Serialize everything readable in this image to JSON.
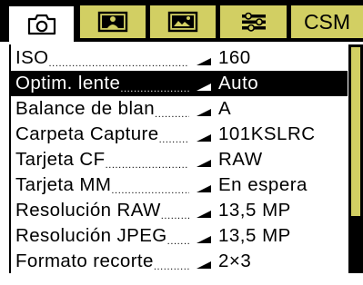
{
  "tabs": [
    {
      "id": "camera",
      "icon": "camera-icon",
      "active": true
    },
    {
      "id": "playback",
      "icon": "playback-icon",
      "active": false
    },
    {
      "id": "image",
      "icon": "image-icon",
      "active": false
    },
    {
      "id": "setup",
      "icon": "wrench-icon",
      "active": false
    },
    {
      "id": "csm",
      "label": "CSM",
      "active": false
    }
  ],
  "menu": {
    "items": [
      {
        "label": "ISO",
        "value": "160",
        "selected": false
      },
      {
        "label": "Optim. lente",
        "value": "Auto",
        "selected": true
      },
      {
        "label": "Balance de blan",
        "value": "A",
        "selected": false
      },
      {
        "label": "Carpeta Capture",
        "value": "101KSLRC",
        "selected": false
      },
      {
        "label": "Tarjeta CF",
        "value": "RAW",
        "selected": false
      },
      {
        "label": "Tarjeta MM",
        "value": "En espera",
        "selected": false
      },
      {
        "label": "Resolución RAW",
        "value": "13,5 MP",
        "selected": false
      },
      {
        "label": "Resolución JPEG",
        "value": "13,5 MP",
        "selected": false
      },
      {
        "label": "Formato recorte",
        "value": "2×3",
        "selected": false
      }
    ]
  },
  "colors": {
    "tab_inactive": "#d2cf63",
    "background": "#000000",
    "highlight": "#000000",
    "highlight_text": "#ffffff"
  }
}
